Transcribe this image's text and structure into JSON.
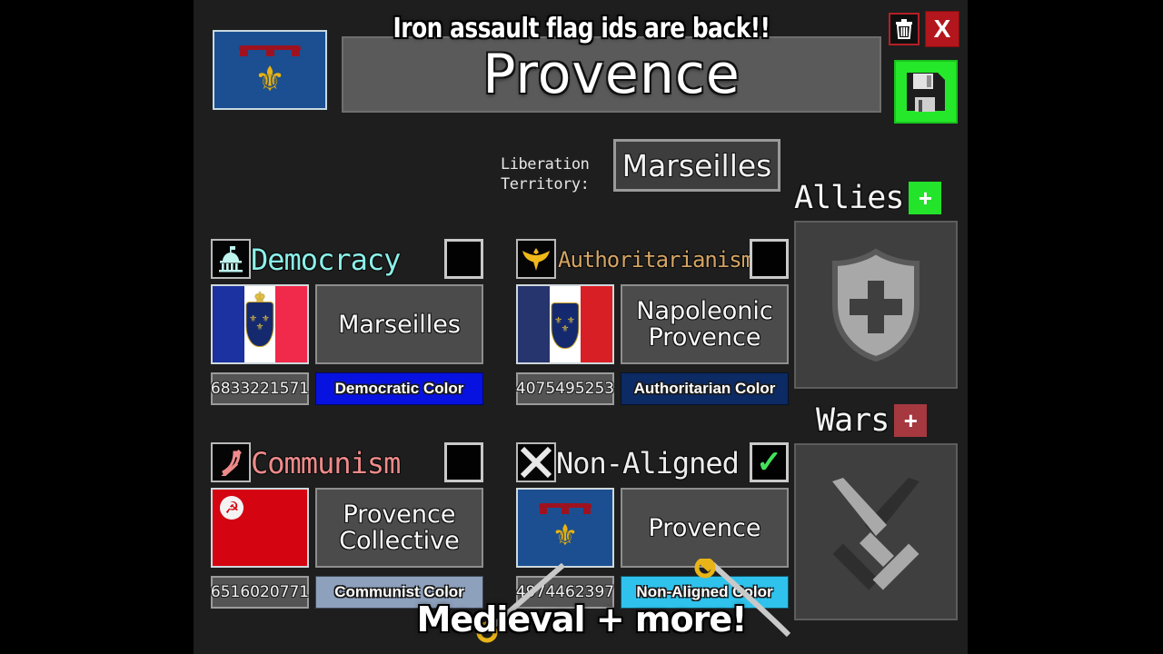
{
  "overlays": {
    "top_banner": "Iron assault flag ids are back!!",
    "bottom_banner": "Medieval + more!",
    "sabre_icon": "sabre-sword-icon"
  },
  "header": {
    "nation_flag_icon": "provence-flag-icon",
    "nation_name": "Provence",
    "delete_button": {
      "icon": "trash-icon",
      "label": ""
    },
    "close_button": {
      "icon": "close-icon",
      "label": "X"
    },
    "save_button": {
      "icon": "floppy-disk-save-icon",
      "label": ""
    },
    "colors": {
      "name_field_bg": "#5a5a5a",
      "close_bg": "#b3161c",
      "save_border": "#26e82a",
      "delete_border": "#b51f25"
    }
  },
  "liberation": {
    "label": "Liberation\nTerritory:",
    "value": "Marseilles"
  },
  "ideologies": [
    {
      "key": "democracy",
      "icon": "capitol-building-icon",
      "title": "Democracy",
      "title_color": "#8bf0e8",
      "checked": false,
      "check_icon": "checkbox-empty-icon",
      "flag_icon": "french-royal-tricolor-flag-icon",
      "flag_type": "tricolor-royal",
      "flag_colors": {
        "left": "#1b32a0",
        "right": "#f1294a"
      },
      "state_name": "Marseilles",
      "flag_id": "6833221571",
      "color_button_label": "Democratic Color",
      "color_button_bg": "#0712e0"
    },
    {
      "key": "authoritarianism",
      "icon": "eagle-icon",
      "title": "Authoritarianism",
      "title_color": "#d4a464",
      "checked": false,
      "check_icon": "checkbox-empty-icon",
      "flag_icon": "french-fleurdelis-tricolor-flag-icon",
      "flag_type": "tricolor-fleur",
      "flag_colors": {
        "left": "#27356e",
        "right": "#d81f26"
      },
      "state_name": "Napoleonic Provence",
      "flag_id": "4075495253",
      "color_button_label": "Authoritarian Color",
      "color_button_bg": "#0c2a63"
    },
    {
      "key": "communism",
      "icon": "hammer-and-sickle-icon",
      "title": "Communism",
      "title_color": "#ef8a8a",
      "checked": false,
      "check_icon": "checkbox-empty-icon",
      "flag_icon": "communist-red-flag-icon",
      "flag_type": "red-hammer-sickle",
      "flag_colors": {
        "left": "#d40511",
        "right": "#d40511"
      },
      "state_name": "Provence Collective",
      "flag_id": "6516020771",
      "color_button_label": "Communist Color",
      "color_button_bg": "#8da0bc"
    },
    {
      "key": "non-aligned",
      "icon": "x-cross-icon",
      "title": "Non-Aligned",
      "title_color": "#ededed",
      "checked": true,
      "check_icon": "checkmark-icon",
      "flag_icon": "provence-flag-icon",
      "flag_type": "provence",
      "flag_colors": {
        "left": "#1b4f92",
        "right": "#1b4f92"
      },
      "state_name": "Provence",
      "flag_id": "4974462397",
      "color_button_label": "Non-Aligned Color",
      "color_button_bg": "#2ec2ec"
    }
  ],
  "sidebar": {
    "allies": {
      "title": "Allies",
      "add_label": "+",
      "add_bg": "#23e32a",
      "placeholder_icon": "shield-cross-icon"
    },
    "wars": {
      "title": "Wars",
      "add_label": "+",
      "add_bg": "#a63840",
      "placeholder_icon": "crossed-swords-icon"
    }
  }
}
